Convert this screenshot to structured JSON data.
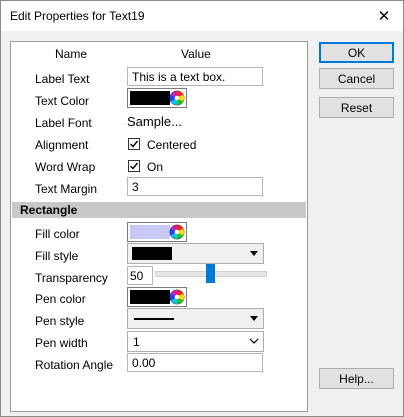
{
  "window": {
    "title": "Edit Properties for Text19"
  },
  "table": {
    "col_name": "Name",
    "col_value": "Value"
  },
  "fields": {
    "label_text": {
      "label": "Label Text",
      "value": "This is a text box."
    },
    "text_color": {
      "label": "Text Color",
      "color": "#000000"
    },
    "label_font": {
      "label": "Label Font",
      "value": "Sample..."
    },
    "alignment": {
      "label": "Alignment",
      "checked": true,
      "option": "Centered"
    },
    "word_wrap": {
      "label": "Word Wrap",
      "checked": true,
      "option": "On"
    },
    "text_margin": {
      "label": "Text Margin",
      "value": "3"
    }
  },
  "section": {
    "title": "Rectangle"
  },
  "rect": {
    "fill_color": {
      "label": "Fill color",
      "color": "#c8c8f8"
    },
    "fill_style": {
      "label": "Fill style",
      "swatch": "#000000"
    },
    "transparency": {
      "label": "Transparency",
      "value": "50",
      "slider_fraction": 0.5
    },
    "pen_color": {
      "label": "Pen color",
      "color": "#000000"
    },
    "pen_style": {
      "label": "Pen style",
      "line": "solid"
    },
    "pen_width": {
      "label": "Pen width",
      "value": "1"
    },
    "rotation_angle": {
      "label": "Rotation Angle",
      "value": "0.00"
    }
  },
  "buttons": {
    "ok": "OK",
    "cancel": "Cancel",
    "reset": "Reset",
    "help": "Help..."
  },
  "icons": {
    "close": "close-icon",
    "color_wheel": "color-wheel-icon",
    "dropdown": "chevron-down-icon"
  },
  "colors": {
    "accent": "#0078d7",
    "section_bg": "#c8c8c8",
    "slider_thumb": "#0078d7"
  }
}
